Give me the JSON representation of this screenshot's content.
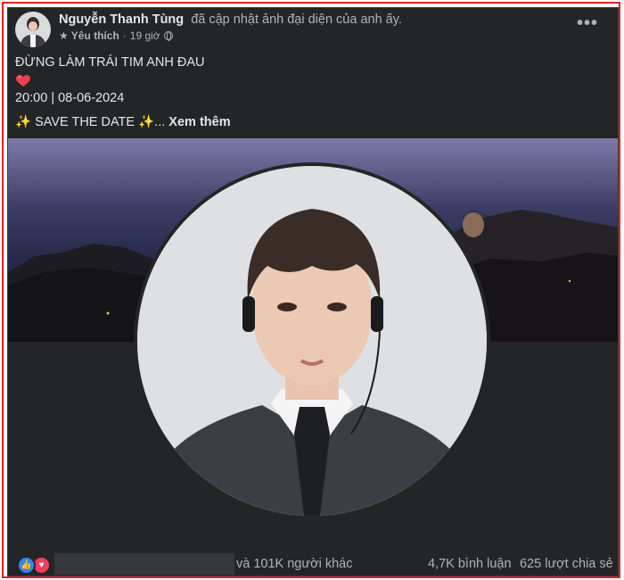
{
  "post": {
    "author_name": "Nguyễn Thanh Tùng",
    "action_text": "đã cập nhật ảnh đại diện của anh ấy.",
    "favorite_label": "Yêu thích",
    "time_ago": "19 giờ",
    "audience_icon": "globe-icon",
    "more_icon": "more-options-icon"
  },
  "content": {
    "line1": "ĐỪNG LÀM TRÁI TIM ANH ĐAU",
    "heart_emoji": "heart-emoji",
    "line2": "20:00 | 08-06-2024",
    "line3_prefix": "✨ SAVE THE DATE ✨",
    "ellipsis": "...",
    "see_more": "Xem thêm"
  },
  "footer": {
    "reactions": [
      "like-icon",
      "love-icon"
    ],
    "others_text": "và 101K người khác",
    "comments_text": "4,7K bình luận",
    "shares_text": "625 lượt chia sẻ"
  },
  "colors": {
    "card_bg": "#242526",
    "text_primary": "#e4e6eb",
    "text_secondary": "#b0b3b8",
    "like_blue": "#2d88ff",
    "love_red": "#f33e58",
    "frame_red": "#e02020"
  }
}
